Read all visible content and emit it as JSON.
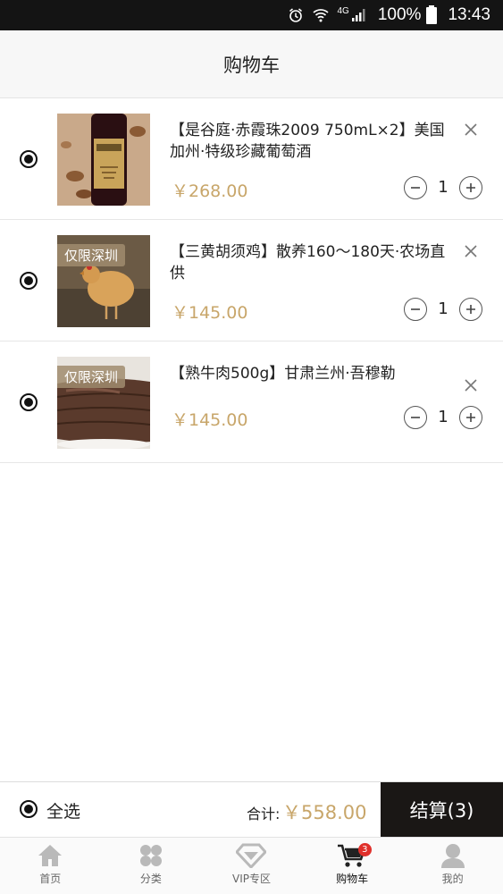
{
  "status_bar": {
    "network": "4G",
    "battery": "100%",
    "time": "13:43"
  },
  "header": {
    "title": "购物车"
  },
  "cart": {
    "items": [
      {
        "title": "【是谷庭·赤霞珠2009 750mL×2】美国加州·特级珍藏葡萄酒",
        "price": "￥268.00",
        "quantity": "1",
        "tag": ""
      },
      {
        "title": "【三黄胡须鸡】散养160～180天·农场直供",
        "price": "￥145.00",
        "quantity": "1",
        "tag": "仅限深圳"
      },
      {
        "title": "【熟牛肉500g】甘肃兰州·吾穆勒",
        "price": "￥145.00",
        "quantity": "1",
        "tag": "仅限深圳"
      }
    ]
  },
  "footer": {
    "select_all": "全选",
    "total_label": "合计:",
    "total_value": "￥558.00",
    "checkout_label": "结算(3)"
  },
  "tabs": [
    {
      "label": "首页",
      "icon": "home-icon"
    },
    {
      "label": "分类",
      "icon": "category-icon"
    },
    {
      "label": "VIP专区",
      "icon": "diamond-icon"
    },
    {
      "label": "购物车",
      "icon": "cart-icon",
      "badge": "3",
      "active": true
    },
    {
      "label": "我的",
      "icon": "user-icon"
    }
  ],
  "colors": {
    "price": "#c8a66a",
    "checkout_bg": "#1a1715",
    "badge": "#e0302b"
  }
}
